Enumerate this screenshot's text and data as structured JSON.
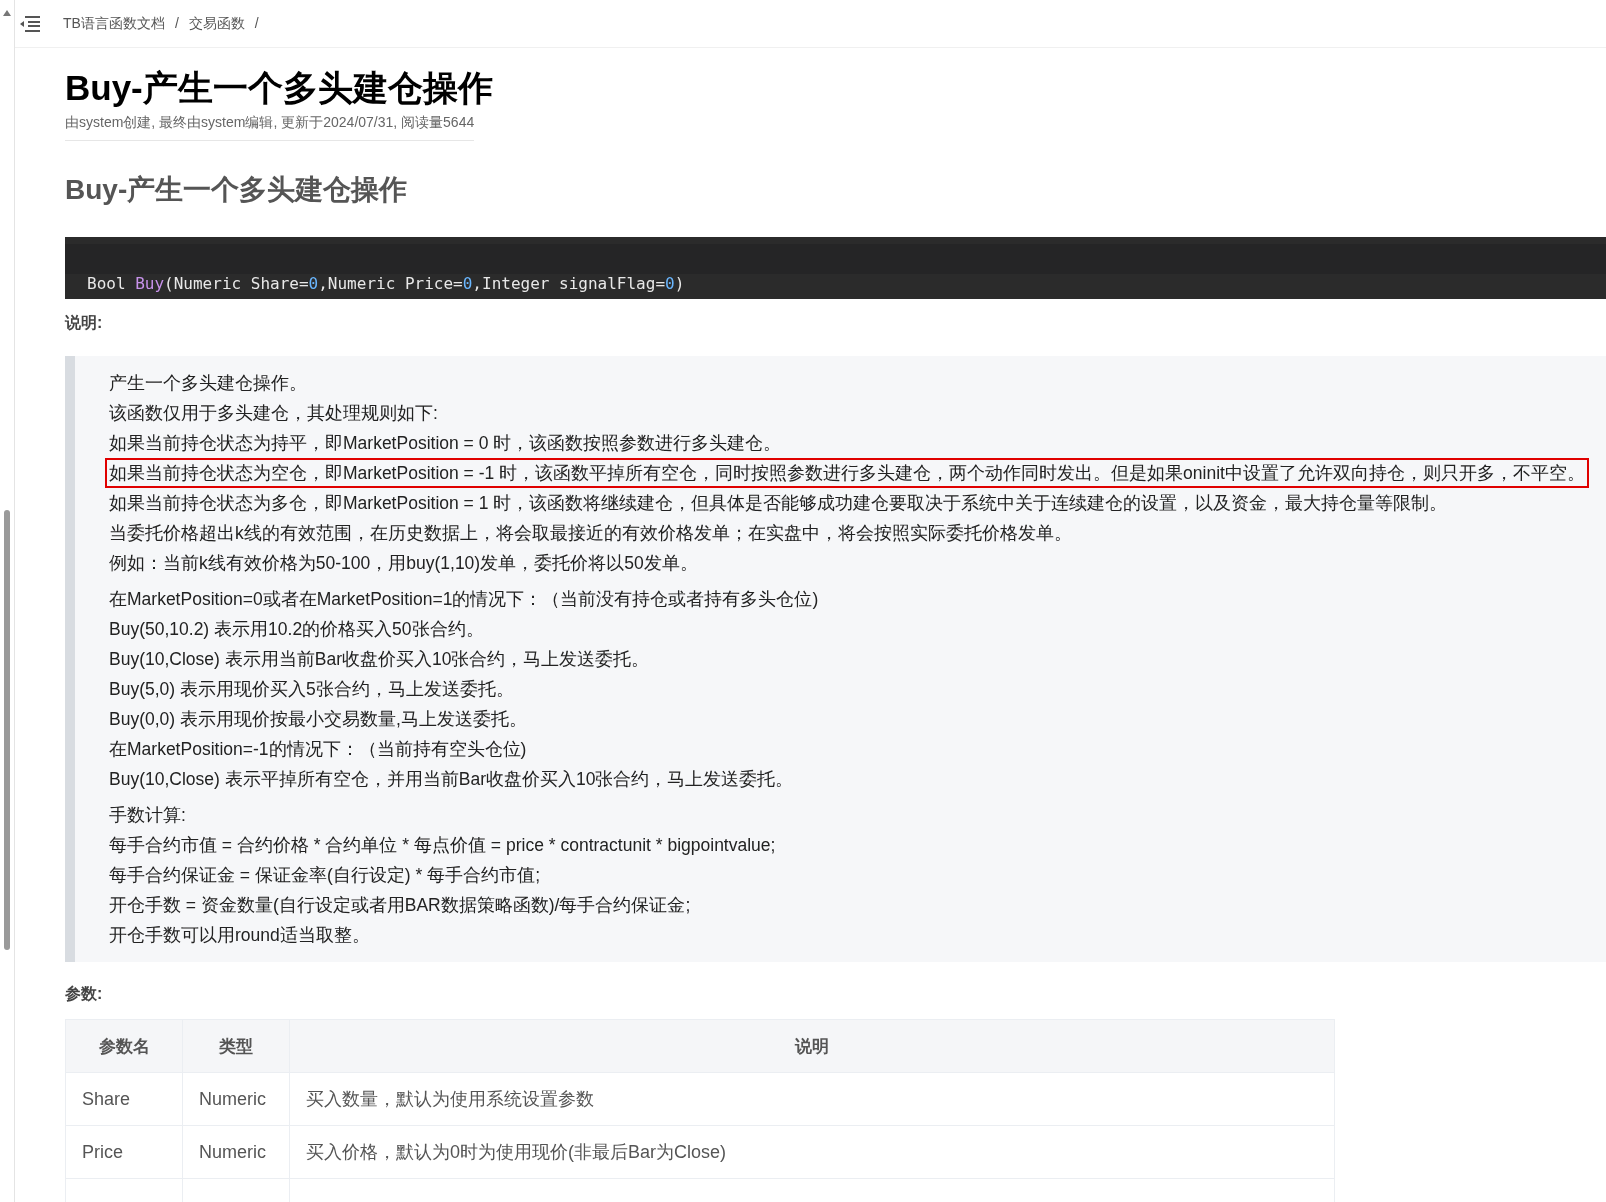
{
  "breadcrumb": [
    {
      "text": "TB语言函数文档",
      "separator": "/"
    },
    {
      "text": "交易函数",
      "separator": "/"
    }
  ],
  "title": "Buy-产生一个多头建仓操作",
  "meta": "由system创建, 最终由system编辑, 更新于2024/07/31, 阅读量5644",
  "heading": "Buy-产生一个多头建仓操作",
  "code": [
    {
      "kind": "plain",
      "text": "Bool "
    },
    {
      "kind": "func",
      "text": "Buy"
    },
    {
      "kind": "plain",
      "text": "(Numeric Share="
    },
    {
      "kind": "number",
      "text": "0"
    },
    {
      "kind": "plain",
      "text": ",Numeric Price="
    },
    {
      "kind": "number",
      "text": "0"
    },
    {
      "kind": "plain",
      "text": ",Integer signalFlag="
    },
    {
      "kind": "number",
      "text": "0"
    },
    {
      "kind": "plain",
      "text": ")"
    }
  ],
  "description_label": "说明:",
  "description": [
    [
      {
        "text": "产生一个多头建仓操作。",
        "highlighted": false
      },
      {
        "text": "该函数仅用于多头建仓，其处理规则如下:",
        "highlighted": false
      },
      {
        "text": "如果当前持仓状态为持平，即MarketPosition = 0 时，该函数按照参数进行多头建仓。",
        "highlighted": false
      },
      {
        "text": "如果当前持仓状态为空仓，即MarketPosition = -1 时，该函数平掉所有空仓，同时按照参数进行多头建仓，两个动作同时发出。但是如果oninit中设置了允许双向持仓，则只开多，不平空。",
        "highlighted": true
      },
      {
        "text": "如果当前持仓状态为多仓，即MarketPosition = 1 时，该函数将继续建仓，但具体是否能够成功建仓要取决于系统中关于连续建仓的设置，以及资金，最大持仓量等限制。",
        "highlighted": false
      },
      {
        "text": "当委托价格超出k线的有效范围，在历史数据上，将会取最接近的有效价格发单；在实盘中，将会按照实际委托价格发单。",
        "highlighted": false
      },
      {
        "text": "例如：当前k线有效价格为50-100，用buy(1,10)发单，委托价将以50发单。",
        "highlighted": false
      }
    ],
    [
      {
        "text": "在MarketPosition=0或者在MarketPosition=1的情况下：（当前没有持仓或者持有多头仓位)",
        "highlighted": false
      },
      {
        "text": "Buy(50,10.2) 表示用10.2的价格买入50张合约。",
        "highlighted": false
      },
      {
        "text": "Buy(10,Close) 表示用当前Bar收盘价买入10张合约，马上发送委托。",
        "highlighted": false
      },
      {
        "text": "Buy(5,0) 表示用现价买入5张合约，马上发送委托。",
        "highlighted": false
      },
      {
        "text": "Buy(0,0) 表示用现价按最小交易数量,马上发送委托。",
        "highlighted": false
      },
      {
        "text": "在MarketPosition=-1的情况下：（当前持有空头仓位)",
        "highlighted": false
      },
      {
        "text": "Buy(10,Close) 表示平掉所有空仓，并用当前Bar收盘价买入10张合约，马上发送委托。",
        "highlighted": false
      }
    ],
    [
      {
        "text": "手数计算:",
        "highlighted": false
      },
      {
        "text": "每手合约市值 = 合约价格 * 合约单位 * 每点价值 = price * contractunit * bigpointvalue;",
        "highlighted": false
      },
      {
        "text": "每手合约保证金 = 保证金率(自行设定) * 每手合约市值;",
        "highlighted": false
      },
      {
        "text": "开仓手数 = 资金数量(自行设定或者用BAR数据策略函数)/每手合约保证金;",
        "highlighted": false
      },
      {
        "text": "开仓手数可以用round适当取整。",
        "highlighted": false
      }
    ]
  ],
  "params_label": "参数:",
  "table": {
    "columns": [
      "参数名",
      "类型",
      "说明"
    ],
    "rows": [
      [
        "Share",
        "Numeric",
        "买入数量，默认为使用系统设置参数"
      ],
      [
        "Price",
        "Numeric",
        "买入价格，默认为0时为使用现价(非最后Bar为Close)"
      ]
    ]
  }
}
